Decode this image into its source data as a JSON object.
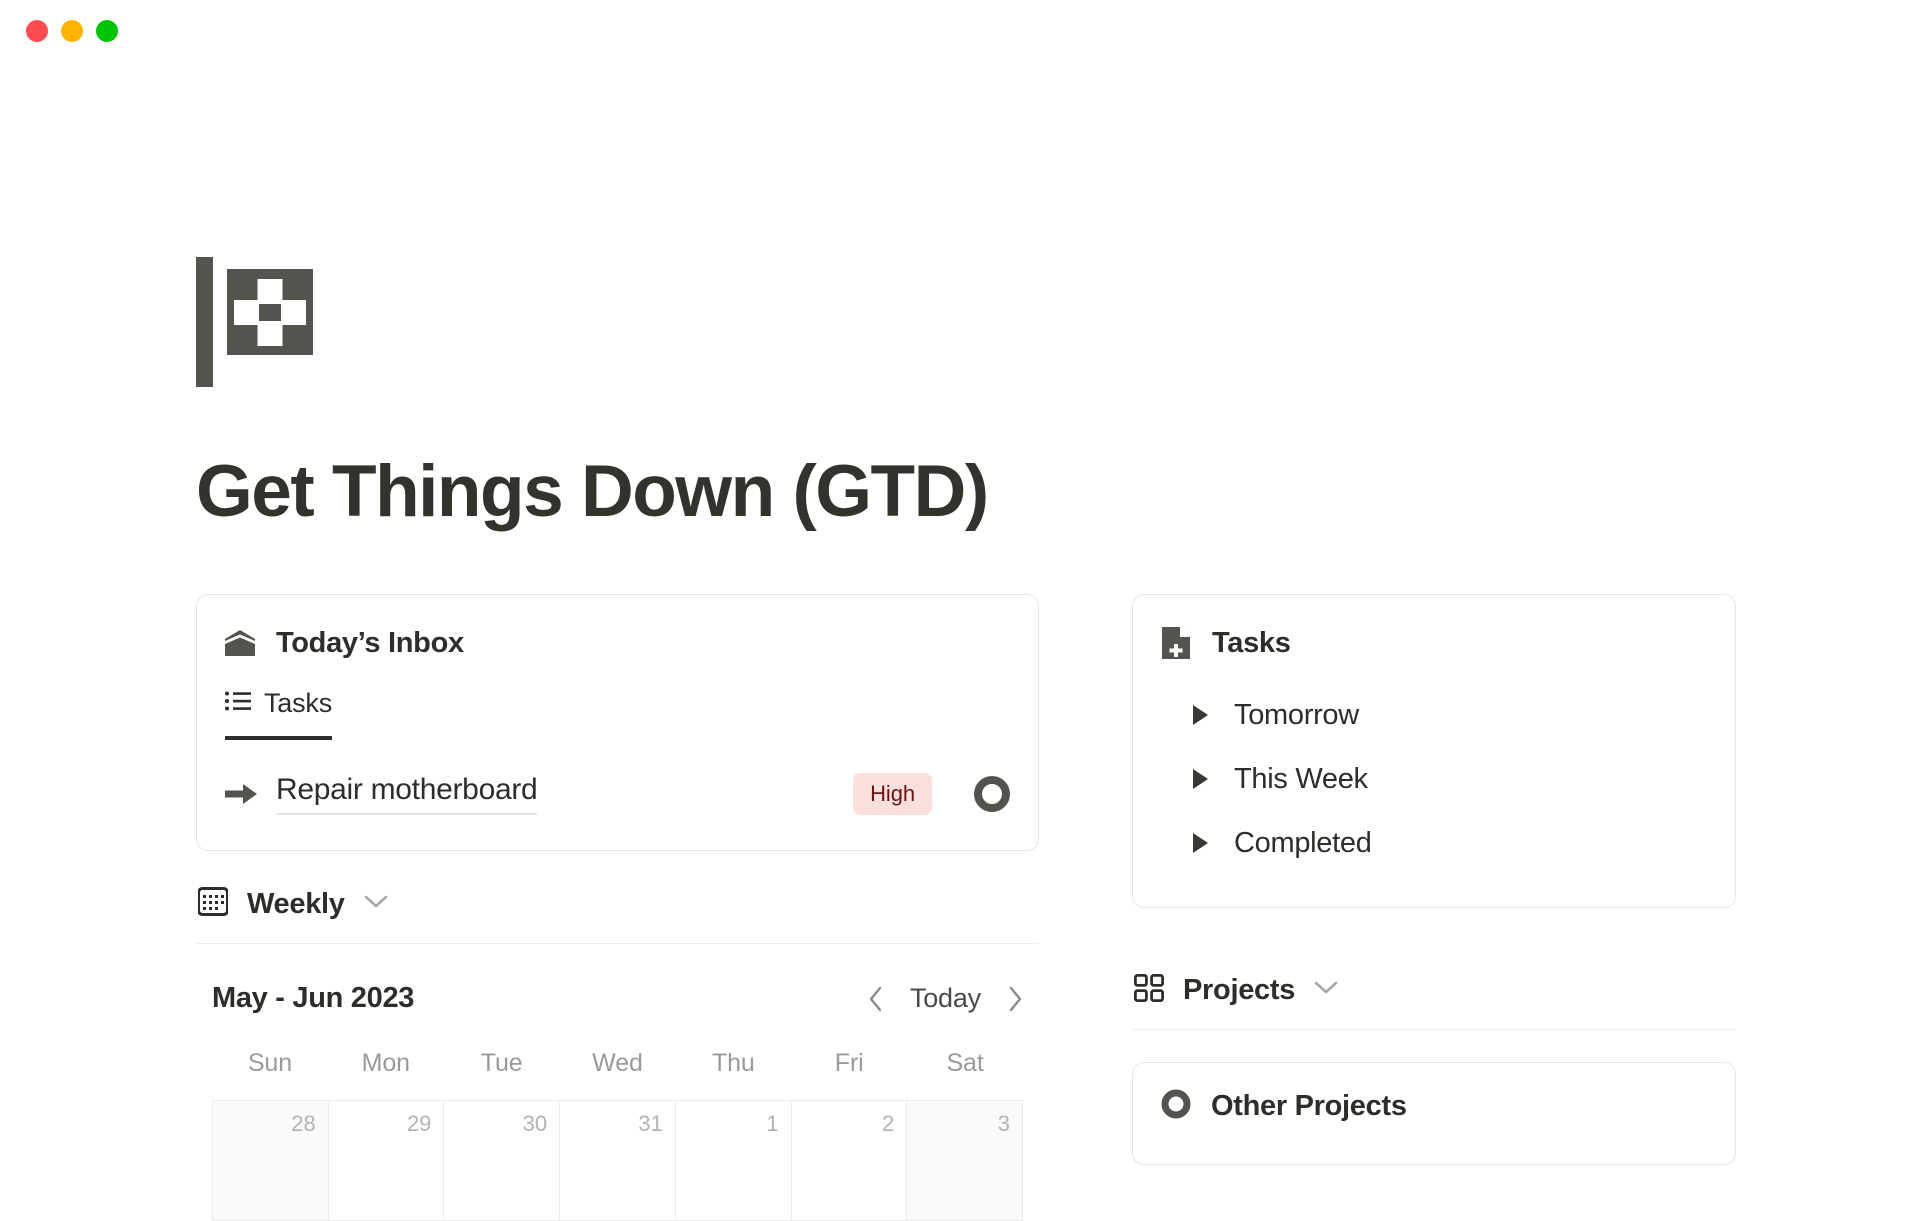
{
  "window": {
    "traffic_lights": [
      {
        "name": "close",
        "color": "#fe4c50"
      },
      {
        "name": "minimize",
        "color": "#ffb403"
      },
      {
        "name": "zoom",
        "color": "#00c403"
      }
    ]
  },
  "page": {
    "icon": "checkered-flag-icon",
    "title": "Get Things Down (GTD)"
  },
  "inbox": {
    "icon": "open-envelope-icon",
    "title": "Today’s Inbox",
    "tabs": [
      {
        "label": "Tasks",
        "icon": "list-icon",
        "active": true
      }
    ],
    "rows": [
      {
        "icon": "arrow-right-icon",
        "title": "Repair motherboard",
        "badge": "High",
        "badge_bg": "#fbdfdc",
        "badge_fg": "#6b1512",
        "status_icon": "progress-circle-icon"
      }
    ]
  },
  "weekly": {
    "icon": "calendar-icon",
    "title": "Weekly",
    "chevron": "chevron-down-icon",
    "calendar": {
      "range": "May - Jun 2023",
      "prev": "chevron-left-icon",
      "today_label": "Today",
      "next": "chevron-right-icon",
      "weekdays": [
        "Sun",
        "Mon",
        "Tue",
        "Wed",
        "Thu",
        "Fri",
        "Sat"
      ],
      "week": [
        {
          "day": "28",
          "weekend": true
        },
        {
          "day": "29",
          "weekend": false
        },
        {
          "day": "30",
          "weekend": false
        },
        {
          "day": "31",
          "weekend": false
        },
        {
          "day": "1",
          "weekend": false
        },
        {
          "day": "2",
          "weekend": false
        },
        {
          "day": "3",
          "weekend": true
        }
      ]
    }
  },
  "tasks_panel": {
    "icon": "file-plus-icon",
    "title": "Tasks",
    "items": [
      {
        "label": "Tomorrow",
        "toggle": "triangle-right-icon"
      },
      {
        "label": "This Week",
        "toggle": "triangle-right-icon"
      },
      {
        "label": "Completed",
        "toggle": "triangle-right-icon"
      }
    ]
  },
  "projects": {
    "icon": "grid-icon",
    "title": "Projects",
    "chevron": "chevron-down-icon",
    "other": {
      "icon": "circle-icon",
      "title": "Other Projects"
    }
  }
}
